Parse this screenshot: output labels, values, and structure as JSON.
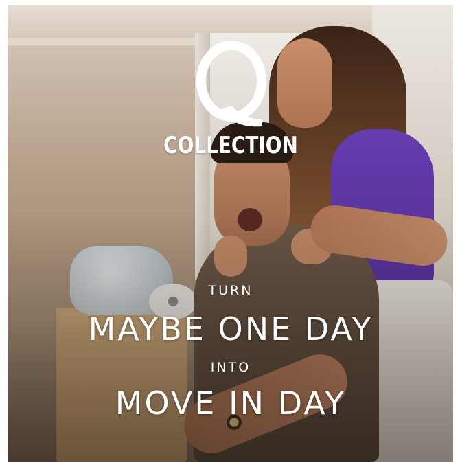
{
  "brand": {
    "logo_letter": "Q",
    "logo_word": "COLLECTION",
    "text_color": "#ffffff"
  },
  "headline": {
    "line1": "TURN",
    "line2": "MAYBE ONE DAY",
    "line3": "INTO",
    "line4": "MOVE IN DAY"
  },
  "photo": {
    "subject": "couple-moving-in-photo"
  }
}
